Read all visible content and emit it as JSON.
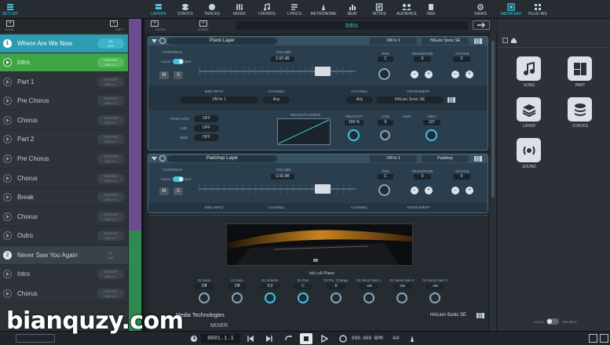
{
  "topbar": {
    "setlist": "SETLIST",
    "tabs": [
      "LAYERS",
      "STACKS",
      "TRACKS",
      "MIXER",
      "CHORDS",
      "LYRICS",
      "METRONOME",
      "BEAT",
      "NOTES",
      "AUDIENCE",
      "DMX"
    ],
    "views": "VIEWS",
    "media_bay": "MEDIA BAY",
    "plug_ins": "PLUG-INS"
  },
  "secondbar": {
    "song": "SONG",
    "part": "PART",
    "layer": "LAYER",
    "zones": "ZONES",
    "title": "Intro"
  },
  "setlist": {
    "songs": [
      {
        "num": "1",
        "label": "Where Are We Now",
        "trigger": "B0\n&24"
      },
      {
        "num": "2",
        "label": "Never Saw You Again",
        "trigger": "B0\n&34"
      }
    ],
    "parts1": [
      {
        "label": "Intro",
        "trigger": "TRIGGER\nMIDI 0 1"
      },
      {
        "label": "Part 1",
        "trigger": "TRIGGER\nMIDI 0 1"
      },
      {
        "label": "Pre Chorus",
        "trigger": "TRIGGER\nMIDI 0 1"
      },
      {
        "label": "Chorus",
        "trigger": "TRIGGER\nMIDI 0 1"
      },
      {
        "label": "Part 2",
        "trigger": "TRIGGER\nMIDI 0 1"
      },
      {
        "label": "Pre Chorus",
        "trigger": "TRIGGER\nMIDI 0 1"
      },
      {
        "label": "Chorus",
        "trigger": "TRIGGER\nMIDI 0 1"
      },
      {
        "label": "Break",
        "trigger": "TRIGGER\nMIDI 0 1"
      },
      {
        "label": "Chorus",
        "trigger": "TRIGGER\nMIDI 0 1"
      },
      {
        "label": "Outro",
        "trigger": "TRIGGER\nMIDI 0 1"
      }
    ],
    "parts2": [
      {
        "label": "Intro",
        "trigger": "TRIGGER\nMIDI 0 1"
      },
      {
        "label": "Chorus",
        "trigger": "TRIGGER\nMIDI 0 1"
      }
    ]
  },
  "layer1": {
    "name": "Piano Layer",
    "vst": "VM In 1",
    "plugin": "HALion Sonic SE",
    "controls": "CONTROLS",
    "audio": "AUDIO",
    "midi": "MIDI",
    "volume_label": "VOLUME",
    "volume": "0.00 dB",
    "pan_label": "PAN",
    "pan": "C",
    "transpose_label": "TRANSPOSE",
    "transpose": "0",
    "octave_label": "OCTAVE",
    "octave": "0",
    "m": "M",
    "s": "S",
    "midi_input_label": "MIDI INPUT",
    "midi_input": "VM In 1",
    "channel_label": "CHANNEL",
    "channel": "Any",
    "channel2_label": "CHANNEL",
    "channel2": "Any",
    "instrument_label": "INSTRUMENT",
    "instrument": "HALion Sonic SE",
    "push_chg": "PUSH CHG",
    "lsb": "LSB",
    "msb": "MSB",
    "off": "OFF",
    "velocity_curve": "VELOCITY CURVE",
    "velocity": "VELOCITY",
    "velocity_val": "100 %",
    "low": "LOW",
    "low_val": "0",
    "limit": "LIMIT",
    "high": "HIGH",
    "high_val": "127"
  },
  "layer2": {
    "name": "Padshop Layer",
    "vst": "VM In 1",
    "plugin": "Padshop",
    "controls": "CONTROLS",
    "audio": "AUDIO",
    "midi": "MIDI",
    "volume_label": "VOLUME",
    "volume": "0.00 dB",
    "pan_label": "PAN",
    "pan": "C",
    "transpose_label": "TRANSPOSE",
    "transpose": "0",
    "octave_label": "OCTAVE",
    "octave": "0",
    "m": "M",
    "s": "S",
    "midi_input_label": "MIDI INPUT",
    "channel_label": "CHANNEL",
    "channel2_label": "CHANNEL",
    "instrument_label": "INSTRUMENT"
  },
  "plugin_panel": {
    "caption": "Intl LoFi Piano",
    "params": [
      {
        "label": "01 Mute",
        "value": "Off"
      },
      {
        "label": "01 Solo",
        "value": "Off"
      },
      {
        "label": "01 Volume",
        "value": "0.0"
      },
      {
        "label": "01 Pan",
        "value": "C"
      },
      {
        "label": "01 Prx. Change",
        "value": "0"
      },
      {
        "label": "01 Send Gain 1",
        "value": "-oo"
      },
      {
        "label": "01 Send Gain 2",
        "value": "-oo"
      },
      {
        "label": "01 Send Gain 3",
        "value": "-oo"
      }
    ],
    "vendor": "Media Technologies",
    "product": "HALion Sonic SE",
    "mixer": "MIXER"
  },
  "mediabay": {
    "items": [
      {
        "label": "SONG",
        "icon": "note-icon"
      },
      {
        "label": "PART",
        "icon": "part-icon"
      },
      {
        "label": "LAYER",
        "icon": "layer-icon"
      },
      {
        "label": "STACKS",
        "icon": "stacks-icon"
      },
      {
        "label": "SOUND",
        "icon": "sound-icon"
      }
    ],
    "local": "LOCAL",
    "project": "PROJECT"
  },
  "transport": {
    "position": "0001.1.1",
    "tempo": "090.000 BPM",
    "signature": "4/4"
  },
  "watermark": "bianquzy.com",
  "colors": {
    "accent": "#3ec7e0",
    "current_song": "#2d9bb0",
    "current_part": "#3fa544",
    "layer_border": "#4a6a80"
  }
}
